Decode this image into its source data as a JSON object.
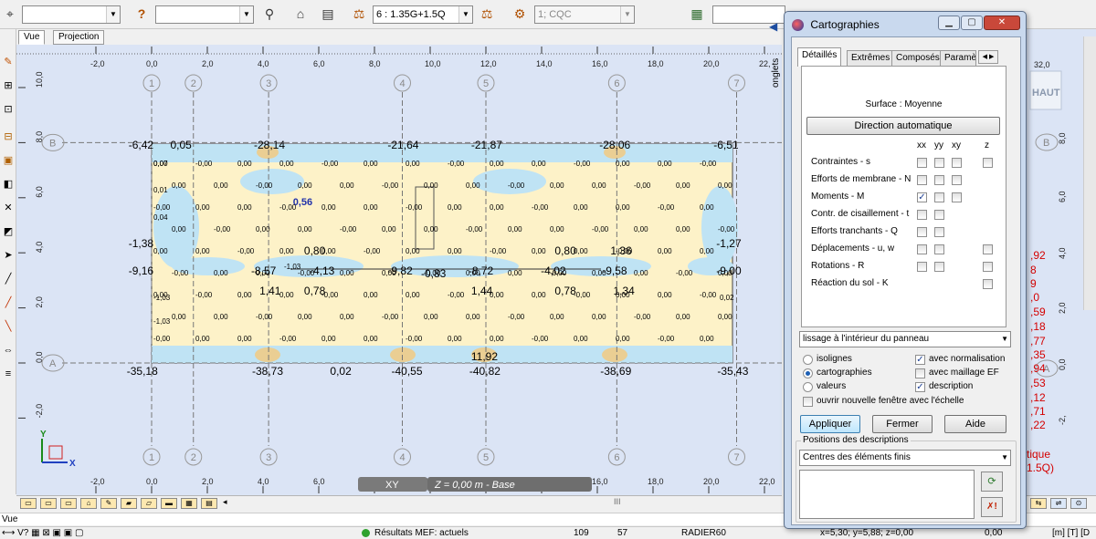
{
  "toolbar": {
    "combo1": "",
    "combo2": "",
    "load_case": "6 : 1.35G+1.5Q",
    "combination": "1; CQC",
    "question_icon": "?"
  },
  "view_tabs": [
    "Vue",
    "Projection"
  ],
  "canvas": {
    "x_ruler": [
      "-2,0",
      "0,0",
      "2,0",
      "4,0",
      "6,0",
      "8,0",
      "10,0",
      "12,0",
      "14,0",
      "16,0",
      "18,0",
      "20,0",
      "22,"
    ],
    "x_ruler_bottom": [
      "-2,0",
      "0,0",
      "2,0",
      "4,0",
      "6,0",
      "8,0",
      "10,0",
      "12,0",
      "14,0",
      "16,0",
      "18,0",
      "20,0",
      "22,0"
    ],
    "y_ruler": [
      "10,0",
      "8,0",
      "6,0",
      "4,0",
      "2,0",
      "0,0",
      "-2,0"
    ],
    "right_ruler": [
      "32,0",
      "8,0",
      "6,0",
      "4,0",
      "2,0",
      "0,0",
      "-2,"
    ],
    "grid_columns": [
      "1",
      "2",
      "3",
      "4",
      "5",
      "6",
      "7"
    ],
    "grid_rows": [
      "B",
      "A"
    ],
    "top_values": [
      "-6,42",
      "0,05",
      "-28,14",
      "-21,64",
      "-21,87",
      "-28,06",
      "-6,51"
    ],
    "bottom_values": [
      "-35,18",
      "-38,73",
      "0,02",
      "-40,55",
      "-40,82",
      "-38,69",
      "-35,43"
    ],
    "mid_values": [
      "-1,38",
      "-9,16",
      "-8,57",
      "-4,13",
      "-9,82",
      "-0,83",
      "-8,72",
      "-4,02",
      "-9,58",
      "-9,00",
      "-1,27",
      "0,80",
      "0,80",
      "1,36",
      "1,41",
      "0,78",
      "1,44",
      "0,78",
      "1,34",
      "11,92",
      "0,56"
    ],
    "small_values": [
      "0,00",
      "-0,00",
      "0,05",
      "0,06",
      "0,07",
      "0,01",
      "0,04",
      "-1,03",
      "0,02",
      "0,03"
    ],
    "right_red_values": [
      ",92",
      "8",
      "9",
      ",0",
      ",59",
      ",18",
      ",77",
      ",35",
      ",94",
      ",53",
      ",12",
      ",71",
      ",22",
      "tique",
      "1.5Q)"
    ],
    "haut_label": "HAUT",
    "plane_xy": "XY",
    "plane_z": "Z = 0,00 m - Base",
    "axis_y": "Y",
    "axis_x": "X"
  },
  "sidebar_onglets": "onglets",
  "scroll_hint": "III",
  "vue_label": "Vue",
  "status": {
    "results": "Résultats MEF: actuels",
    "n1": "109",
    "n2": "57",
    "model": "RADIER60",
    "coords": "x=5,30; y=5,88; z=0,00",
    "value": "0,00",
    "units": "[m] [T] [D"
  },
  "dialog": {
    "title": "Cartographies",
    "tabs": [
      "Détaillés",
      "Extrêmes",
      "Composés",
      "Paramè"
    ],
    "surface_label": "Surface : Moyenne",
    "direction_button": "Direction automatique",
    "columns": [
      "xx",
      "yy",
      "xy",
      "z"
    ],
    "rows": [
      {
        "label": "Contraintes - s",
        "checks": [
          false,
          false,
          false,
          false
        ]
      },
      {
        "label": "Efforts de membrane - N",
        "checks": [
          false,
          false,
          false
        ]
      },
      {
        "label": "Moments - M",
        "checks": [
          true,
          false,
          false
        ]
      },
      {
        "label": "Contr. de cisaillement - t",
        "checks": [
          false,
          false
        ]
      },
      {
        "label": "Efforts tranchants - Q",
        "checks": [
          false,
          false
        ]
      },
      {
        "label": "Déplacements - u, w",
        "checks": [
          false,
          false,
          false
        ]
      },
      {
        "label": "Rotations - R",
        "checks": [
          false,
          false,
          false
        ]
      },
      {
        "label": "Réaction du sol - K",
        "checks": [
          false
        ]
      }
    ],
    "smoothing": "lissage à l'intérieur du panneau",
    "options": {
      "isolignes": "isolignes",
      "cartographies": "cartographies",
      "valeurs": "valeurs",
      "normalisation": "avec normalisation",
      "maillage": "avec maillage EF",
      "description": "description",
      "new_window": "ouvrir nouvelle fenêtre avec l'échelle"
    },
    "apply": "Appliquer",
    "close": "Fermer",
    "help": "Aide",
    "positions_group": "Positions des descriptions",
    "positions_value": "Centres des éléments finis"
  },
  "colors": {
    "canvas_bg": "#dbe4f5",
    "slab_fill": "#fdf2c8",
    "slab_blue": "#bfe3f4",
    "negative_red": "#d40000",
    "dialog_frame": "#c9d9ee"
  }
}
